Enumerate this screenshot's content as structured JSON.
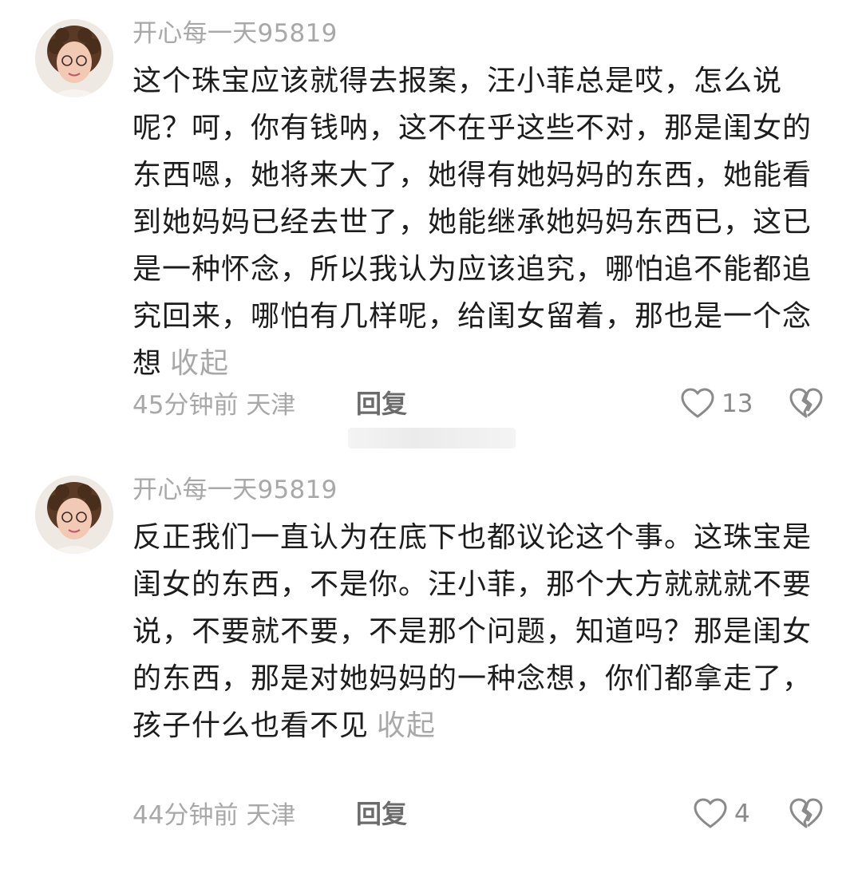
{
  "comments": [
    {
      "username": "开心每一天95819",
      "text": "这个珠宝应该就得去报案，汪小菲总是哎，怎么说呢？呵，你有钱呐，这不在乎这些不对，那是闺女的东西嗯，她将来大了，她得有她妈妈的东西，她能看到她妈妈已经去世了，她能继承她妈妈东西已，这已是一种怀念，所以我认为应该追究，哪怕追不能都追究回来，哪怕有几样呢，给闺女留着，那也是一个念想",
      "collapse_label": "收起",
      "time": "45分钟前",
      "location": "天津",
      "reply_label": "回复",
      "likes": "13"
    },
    {
      "username": "开心每一天95819",
      "text": "反正我们一直认为在底下也都议论这个事。这珠宝是闺女的东西，不是你。汪小菲，那个大方就就就不要说，不要就不要，不是那个问题，知道吗？那是闺女的东西，那是对她妈妈的一种念想，你们都拿走了，孩子什么也看不见",
      "collapse_label": "收起",
      "time": "44分钟前",
      "location": "天津",
      "reply_label": "回复",
      "likes": "4"
    }
  ],
  "icons": {
    "like": "heart-outline-icon",
    "dislike": "broken-heart-icon"
  },
  "colors": {
    "secondary_text": "#a8a8a8",
    "body_text": "#1c1c1c"
  }
}
